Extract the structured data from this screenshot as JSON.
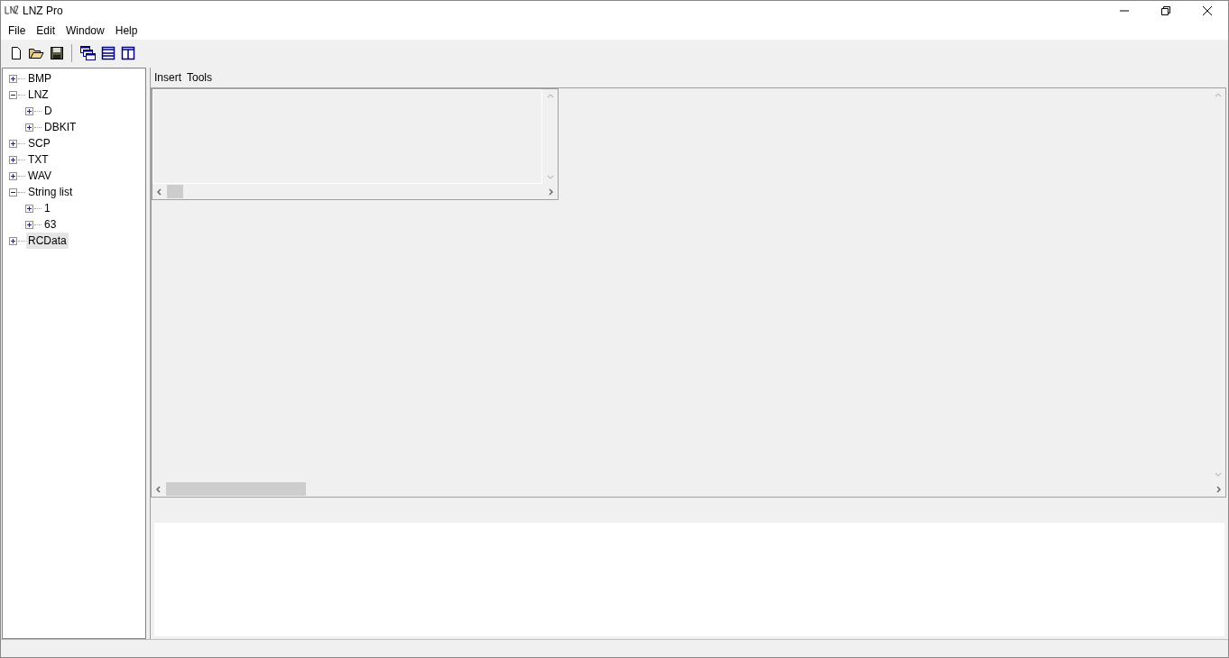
{
  "window": {
    "title": "LNZ Pro"
  },
  "menu": [
    "File",
    "Edit",
    "Window",
    "Help"
  ],
  "tree": [
    {
      "label": "BMP",
      "expanded": false,
      "selected": false
    },
    {
      "label": "LNZ",
      "expanded": true,
      "selected": false,
      "children": [
        {
          "label": "D",
          "expanded": false,
          "selected": false
        },
        {
          "label": "DBKIT",
          "expanded": false,
          "selected": false
        }
      ]
    },
    {
      "label": "SCP",
      "expanded": false,
      "selected": false
    },
    {
      "label": "TXT",
      "expanded": false,
      "selected": false
    },
    {
      "label": "WAV",
      "expanded": false,
      "selected": false
    },
    {
      "label": "String list",
      "expanded": true,
      "selected": false,
      "children": [
        {
          "label": "1",
          "expanded": false,
          "selected": false
        },
        {
          "label": "63",
          "expanded": false,
          "selected": false
        }
      ]
    },
    {
      "label": "RCData",
      "expanded": false,
      "selected": true
    }
  ],
  "submenu": [
    "Insert",
    "Tools"
  ]
}
